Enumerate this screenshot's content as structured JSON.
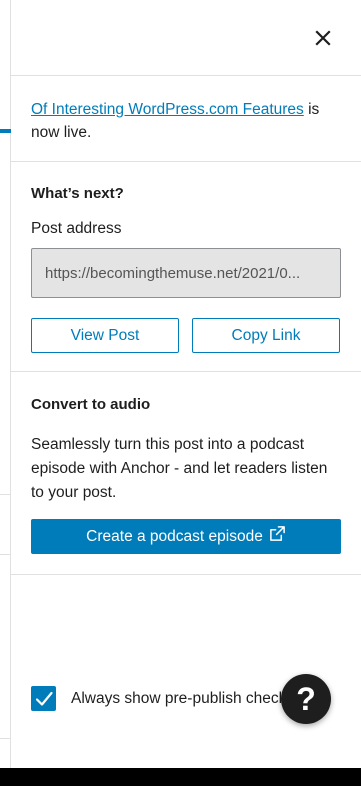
{
  "published": {
    "link_text": "Of Interesting WordPress.com Features",
    "suffix": " is now live."
  },
  "whats_next": {
    "heading": "What’s next?",
    "post_address_label": "Post address",
    "post_address_value": "https://becomingthemuse.net/2021/0...",
    "view_post_label": "View Post",
    "copy_link_label": "Copy Link"
  },
  "convert_audio": {
    "heading": "Convert to audio",
    "description": "Seamlessly turn this post into a podcast episode with Anchor - and let readers listen to your post.",
    "button_label": "Create a podcast episode"
  },
  "prepublish": {
    "label": "Always show pre-publish checks",
    "checked": true
  },
  "help": {
    "label": "?"
  },
  "colors": {
    "accent": "#007cba",
    "text": "#1e1e1e",
    "help_bg": "#1e1e1e"
  },
  "icons": [
    "close-icon",
    "external-link-icon",
    "checkmark-icon",
    "help-icon"
  ]
}
